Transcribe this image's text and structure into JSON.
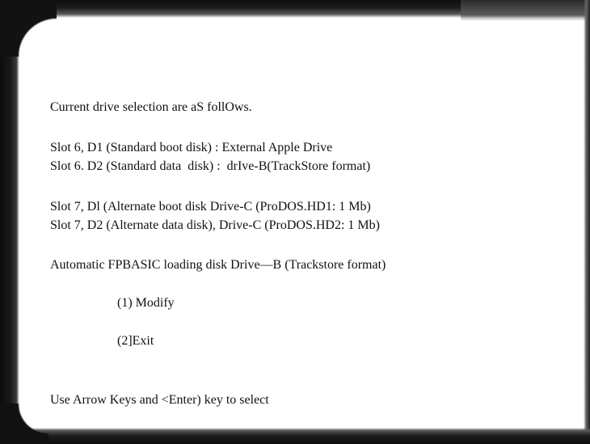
{
  "header": {
    "intro": "Current drive selection are aS follOws."
  },
  "drives": [
    {
      "text": "Slot 6, D1 (Standard boot disk) : External Apple Drive"
    },
    {
      "text": "Slot 6. D2 (Standard data  disk) :  drIve-B(TrackStore format)"
    },
    {
      "text": "Slot 7, Dl (Alternate boot disk Drive-C (ProDOS.HD1: 1 Mb)"
    },
    {
      "text": "Slot 7, D2 (Alternate data disk), Drive-C (ProDOS.HD2: 1 Mb)"
    }
  ],
  "autoload": {
    "text": "Automatic FPBASIC loading disk Drive—B (Trackstore format)"
  },
  "menu": {
    "options": [
      {
        "label": "(1) Modify"
      },
      {
        "label": "(2]Exit"
      }
    ]
  },
  "footer": {
    "hint": "Use Arrow Keys and <Enter) key to select"
  },
  "colors": {
    "background": "#ffffff",
    "text": "#111111",
    "bezel": "#121212"
  }
}
